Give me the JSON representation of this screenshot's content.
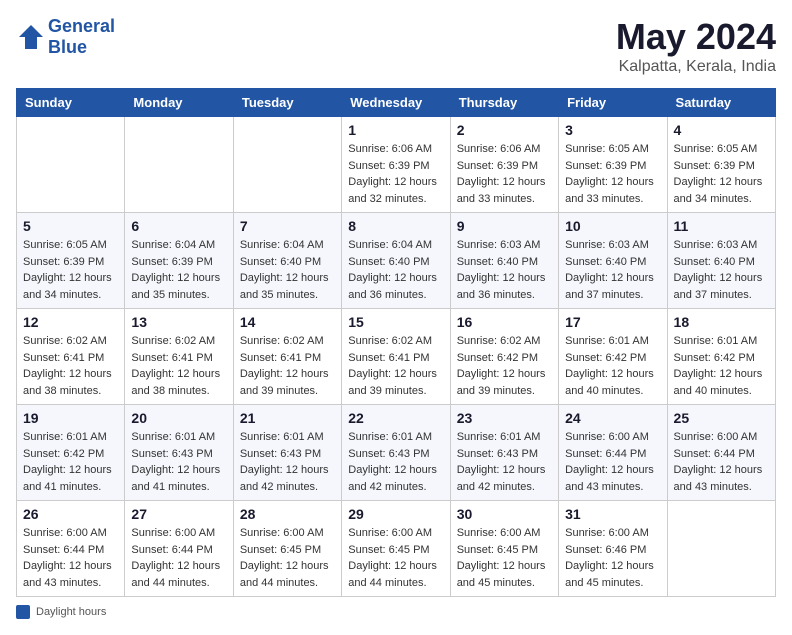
{
  "header": {
    "logo_line1": "General",
    "logo_line2": "Blue",
    "title": "May 2024",
    "subtitle": "Kalpatta, Kerala, India"
  },
  "footer": {
    "daylight_label": "Daylight hours"
  },
  "days_of_week": [
    "Sunday",
    "Monday",
    "Tuesday",
    "Wednesday",
    "Thursday",
    "Friday",
    "Saturday"
  ],
  "weeks": [
    [
      {
        "day": "",
        "sunrise": "",
        "sunset": "",
        "daylight": ""
      },
      {
        "day": "",
        "sunrise": "",
        "sunset": "",
        "daylight": ""
      },
      {
        "day": "",
        "sunrise": "",
        "sunset": "",
        "daylight": ""
      },
      {
        "day": "1",
        "sunrise": "Sunrise: 6:06 AM",
        "sunset": "Sunset: 6:39 PM",
        "daylight": "Daylight: 12 hours and 32 minutes."
      },
      {
        "day": "2",
        "sunrise": "Sunrise: 6:06 AM",
        "sunset": "Sunset: 6:39 PM",
        "daylight": "Daylight: 12 hours and 33 minutes."
      },
      {
        "day": "3",
        "sunrise": "Sunrise: 6:05 AM",
        "sunset": "Sunset: 6:39 PM",
        "daylight": "Daylight: 12 hours and 33 minutes."
      },
      {
        "day": "4",
        "sunrise": "Sunrise: 6:05 AM",
        "sunset": "Sunset: 6:39 PM",
        "daylight": "Daylight: 12 hours and 34 minutes."
      }
    ],
    [
      {
        "day": "5",
        "sunrise": "Sunrise: 6:05 AM",
        "sunset": "Sunset: 6:39 PM",
        "daylight": "Daylight: 12 hours and 34 minutes."
      },
      {
        "day": "6",
        "sunrise": "Sunrise: 6:04 AM",
        "sunset": "Sunset: 6:39 PM",
        "daylight": "Daylight: 12 hours and 35 minutes."
      },
      {
        "day": "7",
        "sunrise": "Sunrise: 6:04 AM",
        "sunset": "Sunset: 6:40 PM",
        "daylight": "Daylight: 12 hours and 35 minutes."
      },
      {
        "day": "8",
        "sunrise": "Sunrise: 6:04 AM",
        "sunset": "Sunset: 6:40 PM",
        "daylight": "Daylight: 12 hours and 36 minutes."
      },
      {
        "day": "9",
        "sunrise": "Sunrise: 6:03 AM",
        "sunset": "Sunset: 6:40 PM",
        "daylight": "Daylight: 12 hours and 36 minutes."
      },
      {
        "day": "10",
        "sunrise": "Sunrise: 6:03 AM",
        "sunset": "Sunset: 6:40 PM",
        "daylight": "Daylight: 12 hours and 37 minutes."
      },
      {
        "day": "11",
        "sunrise": "Sunrise: 6:03 AM",
        "sunset": "Sunset: 6:40 PM",
        "daylight": "Daylight: 12 hours and 37 minutes."
      }
    ],
    [
      {
        "day": "12",
        "sunrise": "Sunrise: 6:02 AM",
        "sunset": "Sunset: 6:41 PM",
        "daylight": "Daylight: 12 hours and 38 minutes."
      },
      {
        "day": "13",
        "sunrise": "Sunrise: 6:02 AM",
        "sunset": "Sunset: 6:41 PM",
        "daylight": "Daylight: 12 hours and 38 minutes."
      },
      {
        "day": "14",
        "sunrise": "Sunrise: 6:02 AM",
        "sunset": "Sunset: 6:41 PM",
        "daylight": "Daylight: 12 hours and 39 minutes."
      },
      {
        "day": "15",
        "sunrise": "Sunrise: 6:02 AM",
        "sunset": "Sunset: 6:41 PM",
        "daylight": "Daylight: 12 hours and 39 minutes."
      },
      {
        "day": "16",
        "sunrise": "Sunrise: 6:02 AM",
        "sunset": "Sunset: 6:42 PM",
        "daylight": "Daylight: 12 hours and 39 minutes."
      },
      {
        "day": "17",
        "sunrise": "Sunrise: 6:01 AM",
        "sunset": "Sunset: 6:42 PM",
        "daylight": "Daylight: 12 hours and 40 minutes."
      },
      {
        "day": "18",
        "sunrise": "Sunrise: 6:01 AM",
        "sunset": "Sunset: 6:42 PM",
        "daylight": "Daylight: 12 hours and 40 minutes."
      }
    ],
    [
      {
        "day": "19",
        "sunrise": "Sunrise: 6:01 AM",
        "sunset": "Sunset: 6:42 PM",
        "daylight": "Daylight: 12 hours and 41 minutes."
      },
      {
        "day": "20",
        "sunrise": "Sunrise: 6:01 AM",
        "sunset": "Sunset: 6:43 PM",
        "daylight": "Daylight: 12 hours and 41 minutes."
      },
      {
        "day": "21",
        "sunrise": "Sunrise: 6:01 AM",
        "sunset": "Sunset: 6:43 PM",
        "daylight": "Daylight: 12 hours and 42 minutes."
      },
      {
        "day": "22",
        "sunrise": "Sunrise: 6:01 AM",
        "sunset": "Sunset: 6:43 PM",
        "daylight": "Daylight: 12 hours and 42 minutes."
      },
      {
        "day": "23",
        "sunrise": "Sunrise: 6:01 AM",
        "sunset": "Sunset: 6:43 PM",
        "daylight": "Daylight: 12 hours and 42 minutes."
      },
      {
        "day": "24",
        "sunrise": "Sunrise: 6:00 AM",
        "sunset": "Sunset: 6:44 PM",
        "daylight": "Daylight: 12 hours and 43 minutes."
      },
      {
        "day": "25",
        "sunrise": "Sunrise: 6:00 AM",
        "sunset": "Sunset: 6:44 PM",
        "daylight": "Daylight: 12 hours and 43 minutes."
      }
    ],
    [
      {
        "day": "26",
        "sunrise": "Sunrise: 6:00 AM",
        "sunset": "Sunset: 6:44 PM",
        "daylight": "Daylight: 12 hours and 43 minutes."
      },
      {
        "day": "27",
        "sunrise": "Sunrise: 6:00 AM",
        "sunset": "Sunset: 6:44 PM",
        "daylight": "Daylight: 12 hours and 44 minutes."
      },
      {
        "day": "28",
        "sunrise": "Sunrise: 6:00 AM",
        "sunset": "Sunset: 6:45 PM",
        "daylight": "Daylight: 12 hours and 44 minutes."
      },
      {
        "day": "29",
        "sunrise": "Sunrise: 6:00 AM",
        "sunset": "Sunset: 6:45 PM",
        "daylight": "Daylight: 12 hours and 44 minutes."
      },
      {
        "day": "30",
        "sunrise": "Sunrise: 6:00 AM",
        "sunset": "Sunset: 6:45 PM",
        "daylight": "Daylight: 12 hours and 45 minutes."
      },
      {
        "day": "31",
        "sunrise": "Sunrise: 6:00 AM",
        "sunset": "Sunset: 6:46 PM",
        "daylight": "Daylight: 12 hours and 45 minutes."
      },
      {
        "day": "",
        "sunrise": "",
        "sunset": "",
        "daylight": ""
      }
    ]
  ]
}
